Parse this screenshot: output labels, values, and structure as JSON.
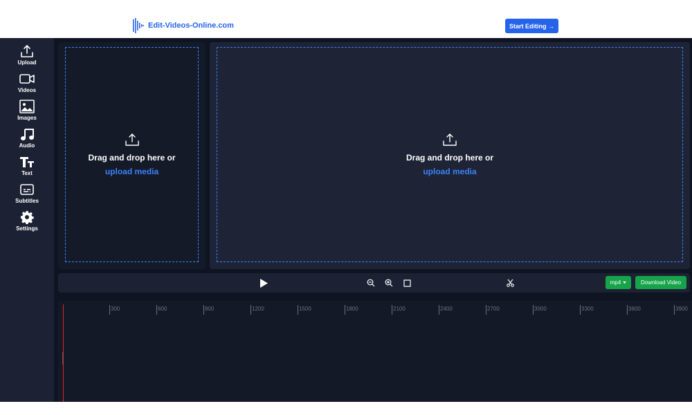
{
  "header": {
    "brand_name": "Edit-Videos-Online.com",
    "start_button": "Start Editing →"
  },
  "sidebar": {
    "items": [
      {
        "label": "Upload",
        "icon": "upload-icon"
      },
      {
        "label": "Videos",
        "icon": "video-camera-icon"
      },
      {
        "label": "Images",
        "icon": "image-icon"
      },
      {
        "label": "Audio",
        "icon": "music-note-icon"
      },
      {
        "label": "Text",
        "icon": "text-icon"
      },
      {
        "label": "Subtitles",
        "icon": "subtitles-icon"
      },
      {
        "label": "Settings",
        "icon": "gear-icon"
      }
    ]
  },
  "media_panel": {
    "drop_text": "Drag and drop here or",
    "upload_link": "upload media"
  },
  "preview_panel": {
    "drop_text": "Drag and drop here or",
    "upload_link": "upload media"
  },
  "controls": {
    "format_value": "mp4",
    "download_label": "Download Video"
  },
  "timeline": {
    "ruler_labels": [
      "300",
      "600",
      "900",
      "1200",
      "1500",
      "1800",
      "2100",
      "2400",
      "2700",
      "3000",
      "3300",
      "3600",
      "3900"
    ]
  },
  "colors": {
    "accent_blue": "#2563eb",
    "drop_border": "#3b82f6",
    "success_green": "#16a34a",
    "playhead_red": "#dc2626",
    "app_background": "#0f1422"
  }
}
